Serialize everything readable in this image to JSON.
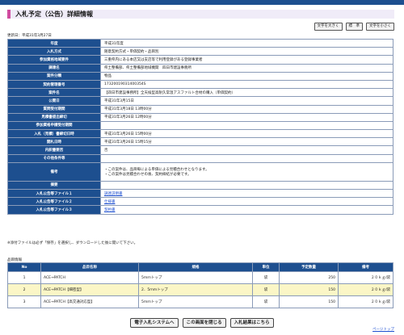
{
  "page": {
    "title": "入札予定（公告）詳細情報",
    "updated": "更新日：平成31年3月27日"
  },
  "font_buttons": [
    "文字を大きく",
    "標　準",
    "文字を小さく"
  ],
  "details": [
    {
      "label": "年度",
      "value": "平成31年度"
    },
    {
      "label": "入札方式",
      "value": "随意契約方式・単価契約・品目別"
    },
    {
      "label": "参加資格地域要件",
      "value": "三重県内にある本店又は支店等で利用登録がある登録事業者"
    },
    {
      "label": "調達名",
      "value": "県土整備部、県土整備部地域機関　四日市建設事務所"
    },
    {
      "label": "案件分類",
      "value": "物品"
    },
    {
      "label": "契約管理番号",
      "value": "17320019031400354S"
    },
    {
      "label": "案件名",
      "value": "【四日市建設事務所】全天候型高耐久常温アスファルト合材の購入（単価契約）"
    },
    {
      "label": "公開日",
      "value": "平成31年3月15日"
    },
    {
      "label": "質問受付期間",
      "value": "平成31年3月18日 13時00分"
    },
    {
      "label": "見積書提出締切",
      "value": "平成31年3月26日 12時00分"
    },
    {
      "label": "参加資格申請受付期間",
      "value": ""
    },
    {
      "label": "入札（見積）書締切日時",
      "value": "平成31年3月26日 15時00分"
    },
    {
      "label": "開札日時",
      "value": "平成31年3月26日 15時15分"
    },
    {
      "label": "内訳書要否",
      "value": "否"
    },
    {
      "label": "その他条件等",
      "value": ""
    },
    {
      "label": "備考",
      "value": "・この案件は、品目毎による単価による見積合わせとなります。\n・この案件は見積合わせの後、契約締結が必要です。"
    },
    {
      "label": "摘要",
      "value": ""
    },
    {
      "label": "入札公告等ファイル１",
      "value": "調達説明書"
    },
    {
      "label": "入札公告等ファイル２",
      "value": "仕様書"
    },
    {
      "label": "入札公告等ファイル３",
      "value": "契約書"
    }
  ],
  "notice": "※添付ファイルは必ず「保存」を選択し、ダウンロードした後に開いて下さい。",
  "items_caption": "品目情報",
  "items_headers": [
    "No",
    "品目名称",
    "規格",
    "単位",
    "予定数量",
    "備考"
  ],
  "items": [
    {
      "no": "1",
      "name": "ACE→PATCH",
      "spec": "5ｍｍトップ",
      "unit": "袋",
      "qty": "250",
      "note": "２０ｋｇ/袋"
    },
    {
      "no": "2",
      "name": "ACE→PATCH【細密型】",
      "spec": "2．5ｍｍトップ",
      "unit": "袋",
      "qty": "150",
      "note": "２０ｋｇ/袋"
    },
    {
      "no": "3",
      "name": "ACE→PATCH【高交通対応型】",
      "spec": "5ｍｍトップ",
      "unit": "袋",
      "qty": "150",
      "note": "２０ｋｇ/袋"
    }
  ],
  "bottom_buttons": [
    "電子入札システムへ",
    "この画面を閉じる",
    "入札結果はこちら"
  ],
  "back_to_top": "ページトップ"
}
